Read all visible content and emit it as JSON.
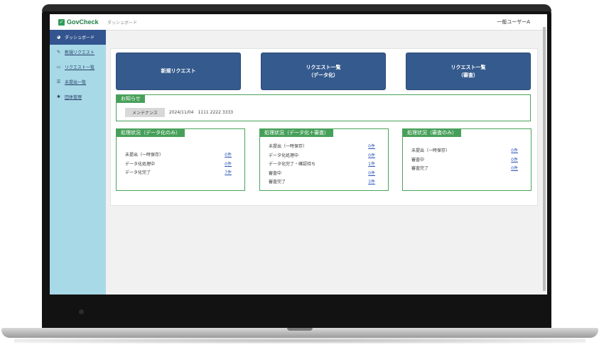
{
  "app": {
    "logo_text": "GovCheck",
    "logo_mark": "✓"
  },
  "sidebar": {
    "items": [
      {
        "label": "ダッシュボード",
        "icon": "dashboard-icon",
        "glyph": "◕"
      },
      {
        "label": "新規リクエスト",
        "icon": "edit-icon",
        "glyph": "✎"
      },
      {
        "label": "リクエスト一覧",
        "icon": "list-icon",
        "glyph": "▭"
      },
      {
        "label": "未提出一覧",
        "icon": "menu-icon",
        "glyph": "☰"
      },
      {
        "label": "団体管理",
        "icon": "gear-icon",
        "glyph": "✱"
      }
    ]
  },
  "header": {
    "breadcrumb": "ダッシュボード",
    "user": "一般ユーザーA"
  },
  "buttons": {
    "new_request": "新規リクエスト",
    "list_data": "リクエスト一覧\n（データ化）",
    "list_review": "リクエスト一覧\n（審査）"
  },
  "notice": {
    "title": "お知らせ",
    "tag": "メンテナンス",
    "date": "2024/11/04",
    "text": "1111 2222 3333"
  },
  "status_data": {
    "title": "処理状況（データ化のみ）",
    "rows": [
      {
        "label": "未提出（一時保存）",
        "value": "0件"
      },
      {
        "label": "データ化処理中",
        "value": "0件"
      },
      {
        "label": "データ化完了",
        "value": "7件"
      }
    ]
  },
  "status_both": {
    "title": "処理状況（データ化＋審査）",
    "rows": [
      {
        "label": "未提出（一時保存）",
        "value": "0件"
      },
      {
        "label": "データ化処理中",
        "value": "0件"
      },
      {
        "label": "データ化完了・確認待ち",
        "value": "1件"
      },
      {
        "label": "審査中",
        "value": "0件"
      },
      {
        "label": "審査完了",
        "value": "3件"
      }
    ]
  },
  "status_review": {
    "title": "処理状況（審査のみ）",
    "rows": [
      {
        "label": "未提出（一時保存）",
        "value": "0件"
      },
      {
        "label": "審査中",
        "value": "0件"
      },
      {
        "label": "審査完了",
        "value": "0件"
      }
    ]
  },
  "colors": {
    "sidebar_bg": "#a8d9e6",
    "active_nav": "#33548f",
    "button": "#355a8d",
    "section_green": "#47a05a",
    "link": "#2b56b8"
  }
}
